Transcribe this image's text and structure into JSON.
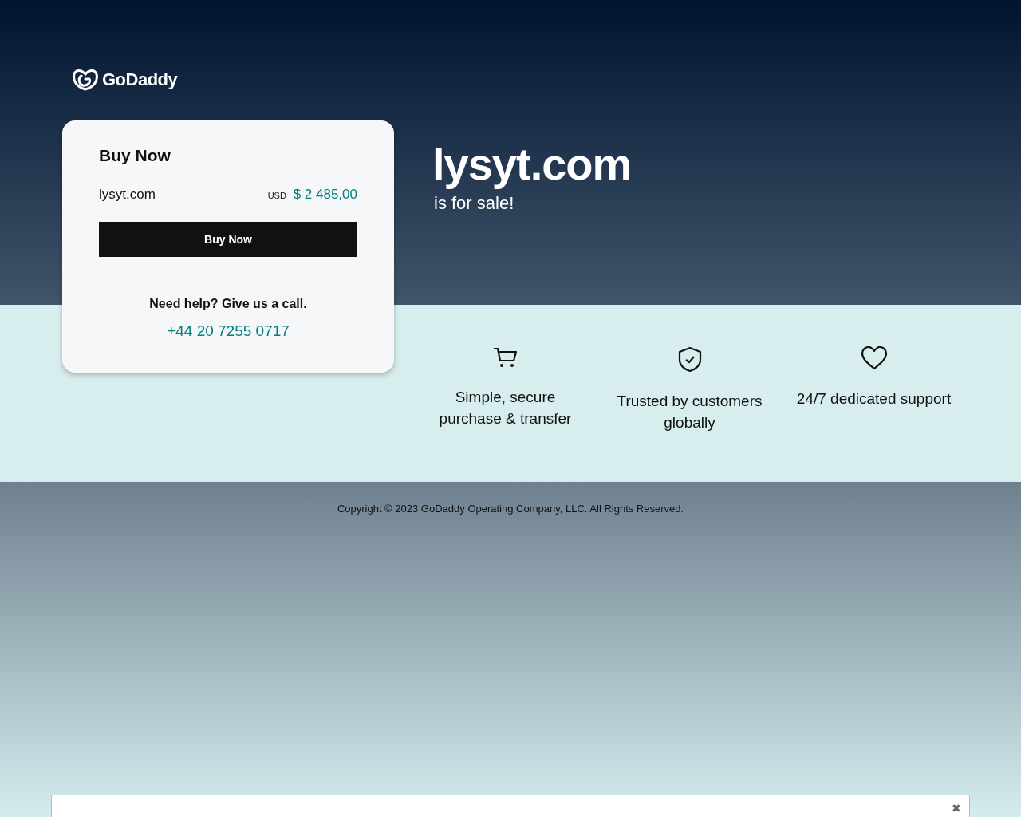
{
  "logo": {
    "text": "GoDaddy"
  },
  "card": {
    "title": "Buy Now",
    "domain": "lysyt.com",
    "currency": "USD",
    "price": "$ 2 485,00",
    "button": "Buy Now",
    "help": "Need help? Give us a call.",
    "phone": "+44 20 7255 0717"
  },
  "hero": {
    "domain": "lysyt.com",
    "subtitle": "is for sale!"
  },
  "features": [
    {
      "kind": "cart",
      "text": "Simple, secure purchase & transfer"
    },
    {
      "kind": "shield",
      "text": "Trusted by customers globally"
    },
    {
      "kind": "heart",
      "text": "24/7 dedicated support"
    }
  ],
  "footer": {
    "copyright": "Copyright © 2023 GoDaddy Operating Company, LLC. All Rights Reserved."
  },
  "banner": {
    "close": "✖"
  }
}
